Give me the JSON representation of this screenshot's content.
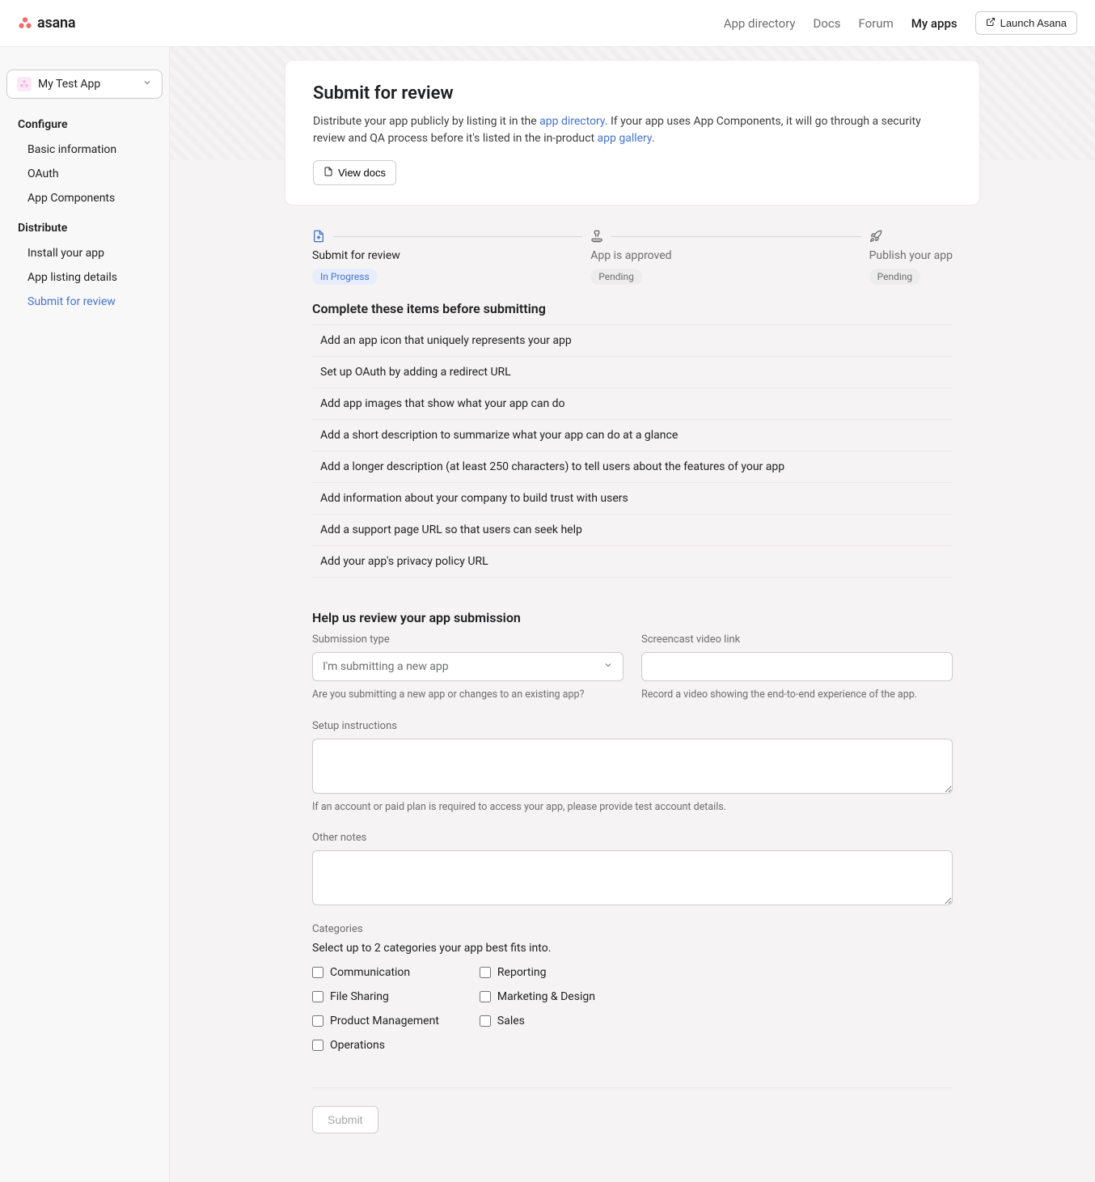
{
  "topnav": {
    "brand": "asana",
    "links": {
      "app_directory": "App directory",
      "docs": "Docs",
      "forum": "Forum",
      "my_apps": "My apps"
    },
    "launch": "Launch Asana"
  },
  "sidebar": {
    "app_select": "My Test App",
    "groups": [
      {
        "heading": "Configure",
        "items": [
          "Basic information",
          "OAuth",
          "App Components"
        ]
      },
      {
        "heading": "Distribute",
        "items": [
          "Install your app",
          "App listing details",
          "Submit for review"
        ]
      }
    ]
  },
  "hero": {
    "title": "Submit for review",
    "desc_pre": "Distribute your app publicly by listing it in the ",
    "link1": "app directory",
    "desc_mid": ". If your app uses App Components, it will go through a security review and QA process before it's listed in the in-product ",
    "link2": "app gallery",
    "desc_post": ".",
    "view_docs": "View docs"
  },
  "stepper": [
    {
      "title": "Submit for review",
      "status": "In Progress",
      "status_class": "progress"
    },
    {
      "title": "App is approved",
      "status": "Pending",
      "status_class": "pending"
    },
    {
      "title": "Publish your app",
      "status": "Pending",
      "status_class": "pending"
    }
  ],
  "checklist": {
    "heading": "Complete these items before submitting",
    "items": [
      "Add an app icon that uniquely represents your app",
      "Set up OAuth by adding a redirect URL",
      "Add app images that show what your app can do",
      "Add a short description to summarize what your app can do at a glance",
      "Add a longer description (at least 250 characters) to tell users about the features of your app",
      "Add information about your company to build trust with users",
      "Add a support page URL so that users can seek help",
      "Add your app's privacy policy URL"
    ]
  },
  "form": {
    "heading": "Help us review your app submission",
    "submission_type": {
      "label": "Submission type",
      "selected": "I'm submitting a new app",
      "help": "Are you submitting a new app or changes to an existing app?"
    },
    "screencast": {
      "label": "Screencast video link",
      "help": "Record a video showing the end-to-end experience of the app."
    },
    "setup": {
      "label": "Setup instructions",
      "help": "If an account or paid plan is required to access your app, please provide test account details."
    },
    "notes": {
      "label": "Other notes"
    },
    "categories": {
      "label": "Categories",
      "hint": "Select up to 2 categories your app best fits into.",
      "col1": [
        "Communication",
        "File Sharing",
        "Product Management",
        "Operations"
      ],
      "col2": [
        "Reporting",
        "Marketing & Design",
        "Sales"
      ]
    },
    "submit": "Submit"
  }
}
